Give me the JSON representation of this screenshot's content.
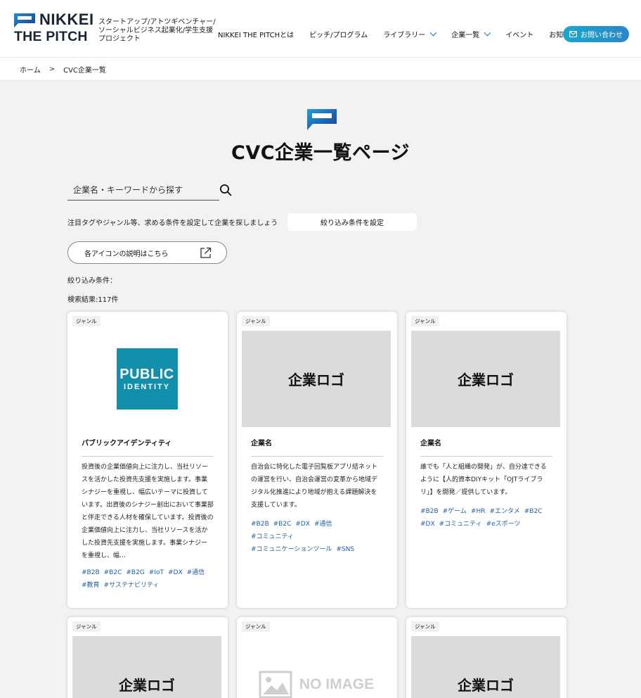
{
  "header": {
    "logo_line1": "NIKKEI",
    "logo_line2": "THE PITCH",
    "tagline": "スタートアップ/アトツギベンチャー/ソーシャルビジネス起業化/学生支援プロジェクト",
    "nav": [
      {
        "label": "NIKKEI THE PITCHとは"
      },
      {
        "label": "ピッチ/プログラム"
      },
      {
        "label": "ライブラリー"
      },
      {
        "label": "企業一覧"
      },
      {
        "label": "イベント"
      },
      {
        "label": "お知らせ"
      }
    ],
    "contact_label": "お問い合わせ",
    "accent": "#1f6fb5"
  },
  "breadcrumb": {
    "home": "ホーム",
    "sep": ">",
    "current": "CVC企業一覧"
  },
  "page": {
    "title": "CVC企業一覧ページ",
    "search_placeholder": "企業名・キーワードから探す",
    "filter_note": "注目タグやジャンル等、求める条件を設定して企業を探しましょう",
    "filter_button": "絞り込み条件を設定",
    "icon_help": "各アイコンの説明はこちら",
    "conditions_label": "絞り込み条件：",
    "results": "検索結果:117件"
  },
  "cards": [
    {
      "genre": "ジャンル",
      "logo_text": "",
      "logo_l1": "PUBLIC",
      "logo_l2": "IDENTITY",
      "name": "パブリックアイデンティティ",
      "desc": "投資後の企業価値向上に注力し、当社リソースを活かした投資先支援を実施します。事業シナジーを重視し、幅広いテーマに投資しています。出資後のシナジー創出において事業部と伴走できる人材を確保しています。投資後の企業価値向上に注力し、当社リソースを活かした投資先支援を実施します。事業シナジーを重視し、幅…",
      "tags": [
        "#B2B",
        "#B2C",
        "#B2G",
        "#IoT",
        "#DX",
        "#通信",
        "#教育",
        "#サステナビリティ"
      ]
    },
    {
      "genre": "ジャンル",
      "logo_text": "企業ロゴ",
      "name": "企業名",
      "desc": "自治会に特化した電子回覧板アプリ結ネットの運営を行い、自治会運営の変革から地域デジタル化推進により地域が抱える課題解決を支援しています。",
      "tags": [
        "#B2B",
        "#B2C",
        "#DX",
        "#通信",
        "#コミュニティ",
        "#コミュニケーションツール",
        "#SNS"
      ]
    },
    {
      "genre": "ジャンル",
      "logo_text": "企業ロゴ",
      "name": "企業名",
      "desc": "誰でも「人と組織の開発」が、自分達できるように【人的資本DIYキット「OJTライブラリ」】を開発／提供しています。",
      "tags": [
        "#B2B",
        "#ゲーム",
        "#HR",
        "#エンタメ",
        "#B2C",
        "#DX",
        "#コミュニティ",
        "#eスポーツ"
      ]
    },
    {
      "genre": "ジャンル",
      "logo_text": "企業ロゴ"
    },
    {
      "genre": "ジャンル",
      "logo_text": "NO IMAGE"
    },
    {
      "genre": "ジャンル",
      "logo_text": "企業ロゴ"
    }
  ]
}
